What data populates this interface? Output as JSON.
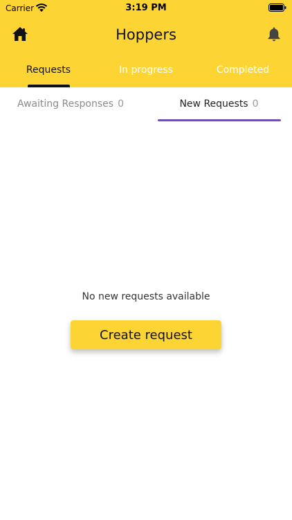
{
  "status_bar": {
    "carrier": "Carrier",
    "time": "3:19 PM"
  },
  "app_bar": {
    "title": "Hoppers",
    "left_icon": "home-icon",
    "right_icon": "bell-icon"
  },
  "tabs": [
    {
      "label": "Requests",
      "active": true
    },
    {
      "label": "In progress",
      "active": false
    },
    {
      "label": "Completed",
      "active": false
    }
  ],
  "subtabs": [
    {
      "label": "Awaiting Responses",
      "count": "0",
      "active": false
    },
    {
      "label": "New Requests",
      "count": "0",
      "active": true
    }
  ],
  "empty_state": {
    "message": "No new requests available",
    "button_label": "Create request"
  },
  "colors": {
    "brand_yellow": "#fcd535",
    "active_indicator": "#6b52b0",
    "tab_indicator": "#111111"
  }
}
